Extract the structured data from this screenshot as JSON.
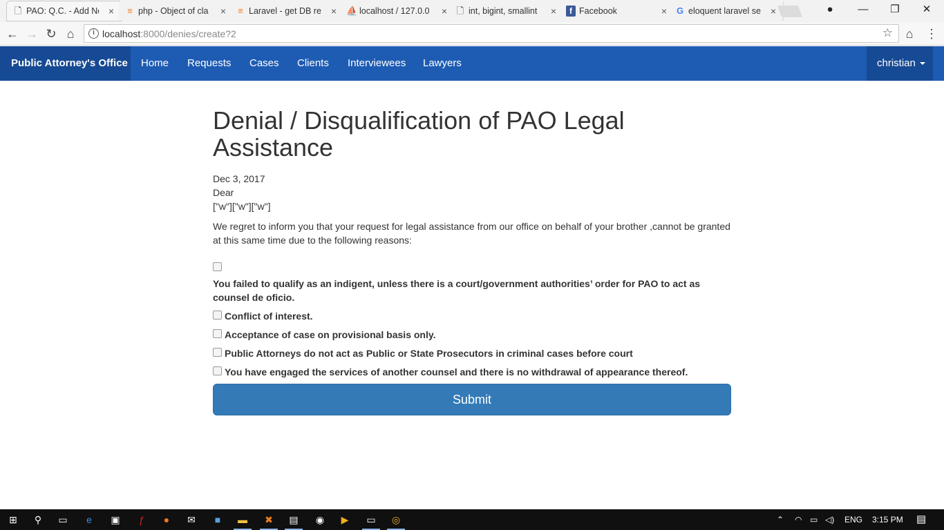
{
  "browser": {
    "tabs": [
      {
        "title": "PAO: Q.C. - Add Ne",
        "icon": "page-icon",
        "active": true
      },
      {
        "title": "php - Object of cla",
        "icon": "stackoverflow-icon"
      },
      {
        "title": "Laravel - get DB re",
        "icon": "stackoverflow-icon"
      },
      {
        "title": "localhost / 127.0.0",
        "icon": "phpmyadmin-icon"
      },
      {
        "title": "int, bigint, smallint",
        "icon": "page-icon"
      },
      {
        "title": "Facebook",
        "icon": "facebook-icon"
      },
      {
        "title": "eloquent laravel se",
        "icon": "google-icon"
      }
    ],
    "tab_close": "×",
    "url_host": "localhost",
    "url_rest": ":8000/denies/create?2"
  },
  "navbar": {
    "brand": "Public Attorney's Office",
    "links": [
      "Home",
      "Requests",
      "Cases",
      "Clients",
      "Interviewees",
      "Lawyers"
    ],
    "user": "christian"
  },
  "letter": {
    "title": "Denial / Disqualification of PAO Legal Assistance",
    "date": "Dec 3, 2017",
    "salutation": "Dear",
    "recipient": "[\"w\"][\"w\"][\"w\"]",
    "intro": "We regret to inform you that your request for legal assistance from our office on behalf of your brother ,cannot be granted at this same time due to the following reasons:"
  },
  "reasons": [
    "You failed to qualify as an indigent, unless there is a court/government authorities’ order for PAO to act as counsel de oficio.",
    "Conflict of interest.",
    "Acceptance of case on provisional basis only.",
    "Public Attorneys do not act as Public or State Prosecutors in criminal cases before court",
    "You have engaged the services of another counsel and there is no withdrawal of appearance thereof."
  ],
  "submit_label": "Submit",
  "taskbar": {
    "language": "ENG",
    "time": "3:15 PM"
  },
  "colors": {
    "navbar": "#1e5cb3",
    "navbar_dark": "#174a94",
    "button": "#337ab7"
  }
}
